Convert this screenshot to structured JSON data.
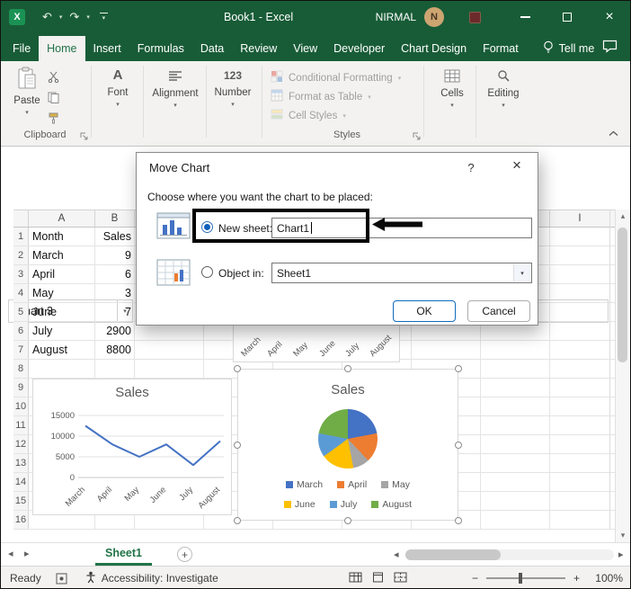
{
  "window": {
    "title": "Book1 - Excel",
    "user_name": "NIRMAL",
    "user_initial": "N"
  },
  "tabs": [
    "File",
    "Home",
    "Insert",
    "Formulas",
    "Data",
    "Review",
    "View",
    "Developer",
    "Chart Design",
    "Format"
  ],
  "tell_me": "Tell me",
  "ribbon": {
    "paste": "Paste",
    "clipboard": "Clipboard",
    "font": "Font",
    "alignment": "Alignment",
    "number": "Number",
    "conditional_formatting": "Conditional Formatting",
    "format_as_table": "Format as Table",
    "cell_styles": "Cell Styles",
    "styles": "Styles",
    "cells": "Cells",
    "editing": "Editing"
  },
  "name_box": "Chart 3",
  "dialog": {
    "title": "Move Chart",
    "help": "?",
    "prompt": "Choose where you want the chart to be placed:",
    "new_sheet_label": "New sheet:",
    "new_sheet_value": "Chart1",
    "object_in_label": "Object in:",
    "object_in_value": "Sheet1",
    "ok": "OK",
    "cancel": "Cancel"
  },
  "columns": {
    "a": "A",
    "b": "B",
    "i": "I"
  },
  "rows": [
    {
      "n": "1",
      "a": "Month",
      "b": "Sales"
    },
    {
      "n": "2",
      "a": "March",
      "b": "9"
    },
    {
      "n": "3",
      "a": "April",
      "b": "6"
    },
    {
      "n": "4",
      "a": "May",
      "b": "3"
    },
    {
      "n": "5",
      "a": "June",
      "b": "7"
    },
    {
      "n": "6",
      "a": "July",
      "b": "2900"
    },
    {
      "n": "7",
      "a": "August",
      "b": "8800"
    },
    {
      "n": "8",
      "a": "",
      "b": ""
    },
    {
      "n": "9",
      "a": "",
      "b": ""
    },
    {
      "n": "10",
      "a": "",
      "b": ""
    },
    {
      "n": "11",
      "a": "",
      "b": ""
    },
    {
      "n": "12",
      "a": "",
      "b": ""
    },
    {
      "n": "13",
      "a": "",
      "b": ""
    },
    {
      "n": "14",
      "a": "",
      "b": ""
    },
    {
      "n": "15",
      "a": "",
      "b": ""
    },
    {
      "n": "16",
      "a": "",
      "b": ""
    }
  ],
  "sheet_tab": "Sheet1",
  "status": {
    "ready": "Ready",
    "accessibility": "Accessibility: Investigate",
    "zoom": "100%"
  },
  "icons": {
    "undo": "↶",
    "redo": "↷",
    "caret": "▾",
    "close": "×",
    "nav_left": "◂",
    "nav_right": "▸",
    "scroll_up": "▴",
    "scroll_down": "▾",
    "add": "+",
    "zoom_out": "−",
    "zoom_in": "+",
    "font_a": "A",
    "number": "123"
  },
  "chart_data": [
    {
      "type": "line",
      "title": "Sales",
      "categories": [
        "March",
        "April",
        "May",
        "June",
        "July",
        "August"
      ],
      "values": [
        12500,
        8000,
        5000,
        8000,
        3000,
        8800
      ],
      "ylim": [
        0,
        15000
      ],
      "yticks_top_down": [
        "15000",
        "10000",
        "5000",
        "0"
      ],
      "series_color": "#4472C4",
      "grid": true,
      "legend_position": "none"
    },
    {
      "type": "pie",
      "title": "Sales",
      "categories": [
        "March",
        "April",
        "May",
        "June",
        "July",
        "August"
      ],
      "values": [
        22,
        16,
        9,
        18,
        13,
        22
      ],
      "colors": [
        "#4472C4",
        "#ED7D31",
        "#A5A5A5",
        "#FFC000",
        "#5B9BD5",
        "#70AD47"
      ],
      "legend_position": "bottom"
    }
  ]
}
